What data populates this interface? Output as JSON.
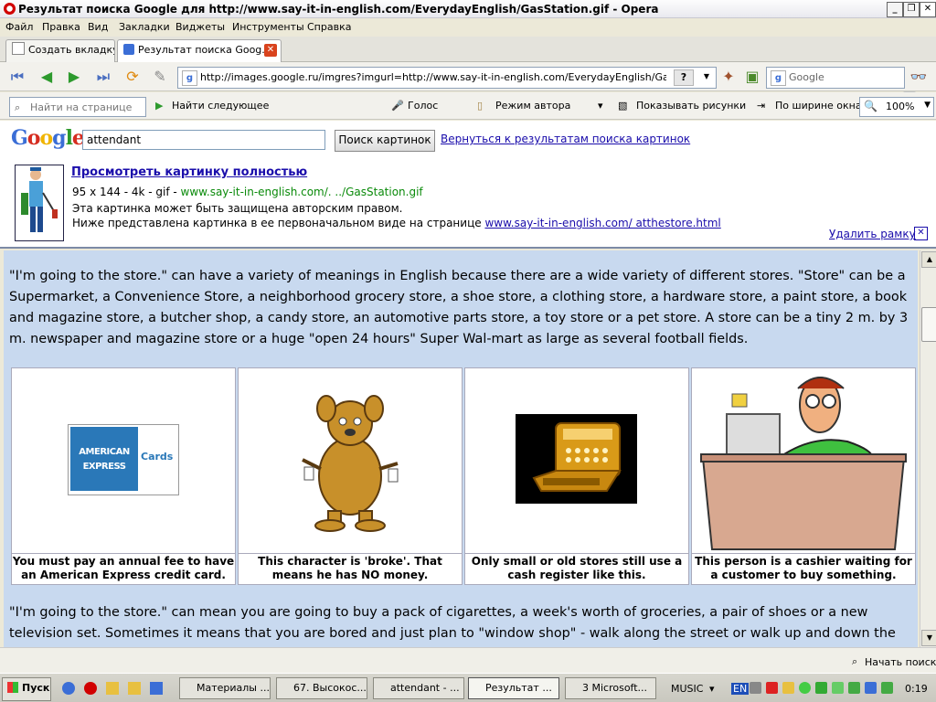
{
  "window": {
    "title": "Результат поиска Google для http://www.say-it-in-english.com/EverydayEnglish/GasStation.gif - Opera"
  },
  "menu": [
    "Файл",
    "Правка",
    "Вид",
    "Закладки",
    "Виджеты",
    "Инструменты",
    "Справка"
  ],
  "tabs": [
    {
      "label": "Создать вкладку"
    },
    {
      "label": "Результат поиска Goog..."
    }
  ],
  "address": {
    "url": "http://images.google.ru/imgres?imgurl=http://www.say-it-in-english.com/EverydayEnglish/GasStation.gif&i",
    "help": "?"
  },
  "search_engine": {
    "placeholder": "Google"
  },
  "findbar": {
    "placeholder": "Найти на странице",
    "find_next": "Найти следующее",
    "voice": "Голос",
    "author_mode": "Режим автора",
    "show_images": "Показывать рисунки",
    "fit_width": "По ширине окна",
    "zoom": "100%"
  },
  "google": {
    "logo": "Google",
    "query": "attendant",
    "search_button": "Поиск картинок",
    "back_link": "Вернуться к результатам поиска картинок",
    "view_full": "Просмотреть картинку полностью",
    "info_prefix": "95 x 144 - 4k - gif - ",
    "info_site": "www.say-it-in-english.com/. ../GasStation.gif",
    "copyright": "Эта картинка может быть защищена авторским правом.",
    "below_prefix": "Ниже представлена картинка в ее первоначальном виде на странице ",
    "below_link": "www.say-it-in-english.com/ atthestore.html",
    "remove_frame": "Удалить рамку"
  },
  "content": {
    "para1": "\"I'm going to the store.\" can have a variety of meanings in English because there are a wide variety of different stores.  \"Store\" can be a Supermarket, a Convenience Store, a neighborhood grocery store, a shoe store, a clothing store, a hardware store, a paint store, a book and magazine store, a butcher shop, a candy store, an automotive parts store, a toy store or a pet store.  A store can be a tiny 2 m. by 3 m.  newspaper and magazine store or a huge \"open 24 hours\" Super Wal-mart as large as several football fields.",
    "amex_top": "AMERICAN",
    "amex_bottom": "EXPRESS",
    "amex_cards": "Cards",
    "captions": [
      "You must pay an annual fee to have an American Express credit card.",
      "This character is 'broke'.  That means he has NO money.",
      "Only small or old stores still use a cash register like this.",
      "This person is a cashier waiting for a customer to buy something."
    ],
    "para2": "\"I'm going to the store.\" can mean you are going to buy a pack of cigarettes, a week's worth of groceries, a pair of shoes or a new television set.  Sometimes it means that you are bored and just plan to \"window shop\" - walk along the street or walk up and down the"
  },
  "status": {
    "start_search": "Начать поиск"
  },
  "taskbar": {
    "start": "Пуск",
    "tasks": [
      "Материалы ...",
      "67. Высокос...",
      "attendant - ...",
      "Результат ...",
      "3 Microsoft..."
    ],
    "music": "MUSIC",
    "lang": "EN",
    "clock": "0:19"
  },
  "colors": {
    "content_bg": "#c8d9ef",
    "link": "#1a0dab",
    "green_url": "#0a8a0a"
  }
}
